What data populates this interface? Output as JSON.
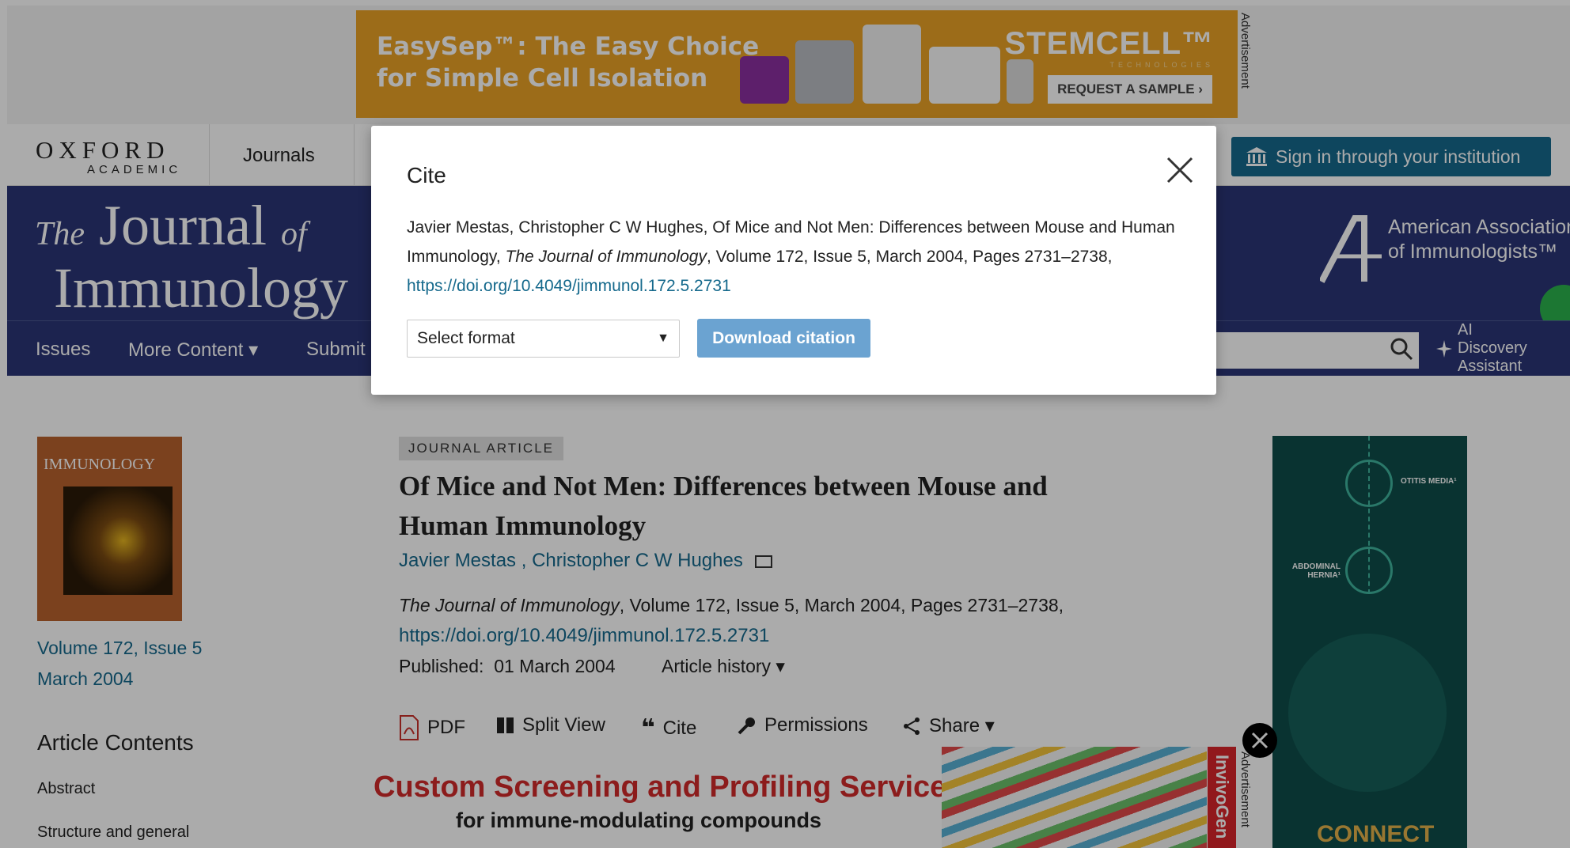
{
  "top_ad": {
    "headline_line1": "EasySep™: The Easy Choice",
    "headline_line2": "for Simple Cell Isolation",
    "brand": "STEMCELL™",
    "brand_sub": "TECHNOLOGIES",
    "cta": "REQUEST A SAMPLE ›",
    "label": "Advertisement"
  },
  "header": {
    "logo_big": "OXFORD",
    "logo_small": "ACADEMIC",
    "journals": "Journals",
    "signin": "Sign in through your institution"
  },
  "journal": {
    "title_the": "The",
    "title_journal": "Journal",
    "title_of": "of",
    "title_immunology": "Immunology",
    "aai": "American Association of Immunologists™"
  },
  "subnav": {
    "issues": "Issues",
    "more_content": "More Content ▾",
    "submit": "Submit",
    "ai_line1": "AI",
    "ai_line2": "Discovery",
    "ai_line3": "Assistant"
  },
  "sidebar": {
    "cover_title": "IMMUNOLOGY",
    "volume": "Volume 172, Issue 5",
    "date": "March 2004",
    "contents_heading": "Article Contents",
    "items": [
      "Abstract",
      "Structure and general"
    ]
  },
  "article": {
    "badge": "JOURNAL ARTICLE",
    "title": "Of Mice and Not Men: Differences between Mouse and Human Immunology",
    "author1": "Javier Mestas",
    "author_sep": " , ",
    "author2": "Christopher C W Hughes",
    "journal_italic": "The Journal of Immunology",
    "citation_rest": ", Volume 172, Issue 5, March 2004, Pages 2731–2738,",
    "doi": "https://doi.org/10.4049/jimmunol.172.5.2731",
    "published_label": "Published:",
    "published_date": "01 March 2004",
    "history": "Article history ▾",
    "tools": {
      "pdf": "PDF",
      "split": "Split View",
      "cite": "Cite",
      "permissions": "Permissions",
      "share": "Share ▾"
    }
  },
  "right_ad": {
    "label1": "OTITIS MEDIA¹",
    "label2": "ABDOMINAL HERNIA¹",
    "connect": "CONNECT"
  },
  "bottom_ad": {
    "headline": "Custom Screening and Profiling Services",
    "sub": "for immune-modulating compounds",
    "brand": "InvivoGen",
    "label": "Advertisement"
  },
  "modal": {
    "title": "Cite",
    "cite_plain": "Javier Mestas, Christopher C W Hughes, Of Mice and Not Men: Differences between Mouse and Human Immunology, ",
    "cite_italic": "The Journal of Immunology",
    "cite_rest": ", Volume 172, Issue 5, March 2004, Pages 2731–2738, ",
    "cite_doi": "https://doi.org/10.4049/jimmunol.172.5.2731",
    "select_value": "Select format",
    "download": "Download citation"
  },
  "colors": {
    "navy": "#2a3577",
    "link": "#15698c",
    "button": "#6ba3d1",
    "ad_orange": "#e9a126"
  }
}
